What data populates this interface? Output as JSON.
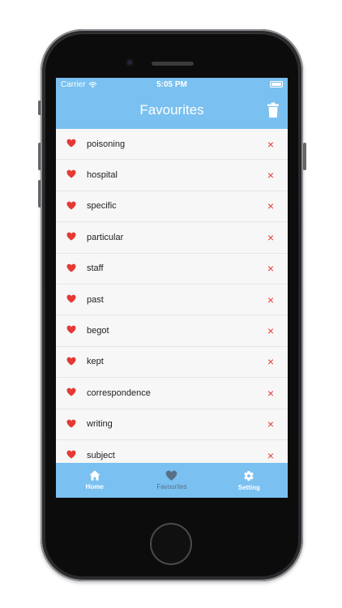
{
  "status_bar": {
    "carrier": "Carrier",
    "time": "5:05 PM"
  },
  "nav": {
    "title": "Favourites"
  },
  "favourites": {
    "items": [
      {
        "word": "poisoning",
        "remove_icon": "×"
      },
      {
        "word": "hospital",
        "remove_icon": "×"
      },
      {
        "word": "specific",
        "remove_icon": "×"
      },
      {
        "word": "particular",
        "remove_icon": "×"
      },
      {
        "word": "staff",
        "remove_icon": "×"
      },
      {
        "word": "past",
        "remove_icon": "×"
      },
      {
        "word": "begot",
        "remove_icon": "×"
      },
      {
        "word": "kept",
        "remove_icon": "×"
      },
      {
        "word": "correspondence",
        "remove_icon": "×"
      },
      {
        "word": "writing",
        "remove_icon": "×"
      },
      {
        "word": "subject",
        "remove_icon": "×"
      }
    ]
  },
  "tab_bar": {
    "home": "Home",
    "favourites": "Favourites",
    "setting": "Setting",
    "active": "favourites"
  },
  "colors": {
    "accent": "#7ac0f0",
    "heart": "#e53935",
    "remove": "#e53935",
    "active_tab": "#58708a"
  },
  "icons": {
    "wifi": "wifi-icon",
    "battery": "battery-icon",
    "trash": "trash-icon",
    "heart": "heart-icon",
    "remove": "close-icon",
    "home": "home-icon",
    "favourites": "heart-icon",
    "setting": "gear-icon"
  }
}
